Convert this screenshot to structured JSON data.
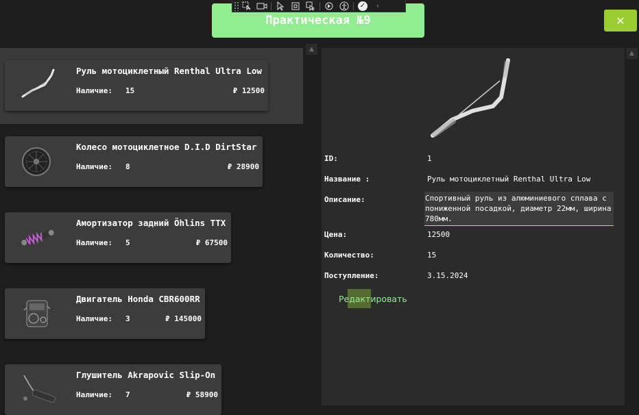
{
  "window": {
    "title": "Практическая №9",
    "close_label": "✕"
  },
  "devtools": {
    "icons": [
      "drag-handle",
      "select-element-icon",
      "video-icon",
      "pointer-icon",
      "layout-bounds-icon",
      "pointer-target-icon",
      "hot-reload-icon",
      "accessibility-icon",
      "check-icon",
      "collapse-icon"
    ]
  },
  "products": [
    {
      "name": "Руль мотоциклетный Renthal Ultra Low",
      "stock_label": "Наличие:",
      "stock": "15",
      "price": "₽ 12500",
      "icon": "handlebar"
    },
    {
      "name": "Колесо мотоциклетное D.I.D DirtStar",
      "stock_label": "Наличие:",
      "stock": "8",
      "price": "₽ 28900",
      "icon": "wheel"
    },
    {
      "name": "Амортизатор задний Öhlins TTX",
      "stock_label": "Наличие:",
      "stock": "5",
      "price": "₽ 67500",
      "icon": "shock"
    },
    {
      "name": "Двигатель Honda CBR600RR",
      "stock_label": "Наличие:",
      "stock": "3",
      "price": "₽ 145000",
      "icon": "engine"
    },
    {
      "name": "Глушитель Akrapovic Slip-On",
      "stock_label": "Наличие:",
      "stock": "7",
      "price": "₽ 58900",
      "icon": "exhaust"
    }
  ],
  "detail": {
    "id_label": "ID:",
    "id": "1",
    "name_label": "Название :",
    "name": "Руль мотоциклетный Renthal Ultra Low",
    "desc_label": "Описание:",
    "desc_line1": "Спортивный руль из алюминиевого сплава с",
    "desc_line2": "пониженной посадкой, диаметр 22мм, ширина",
    "desc_line3": "780мм.",
    "price_label": "Цена:",
    "price": "12500",
    "qty_label": "Количество:",
    "qty": "15",
    "date_label": "Поступление:",
    "date": "3.15.2024",
    "edit_label": "Редактировать"
  },
  "colors": {
    "title_bg": "#90ee90",
    "close_bg": "#9acd32",
    "card_bg": "#3c3c3c",
    "panel_bg": "#2b2b2b",
    "accent_text": "#90ee90"
  }
}
